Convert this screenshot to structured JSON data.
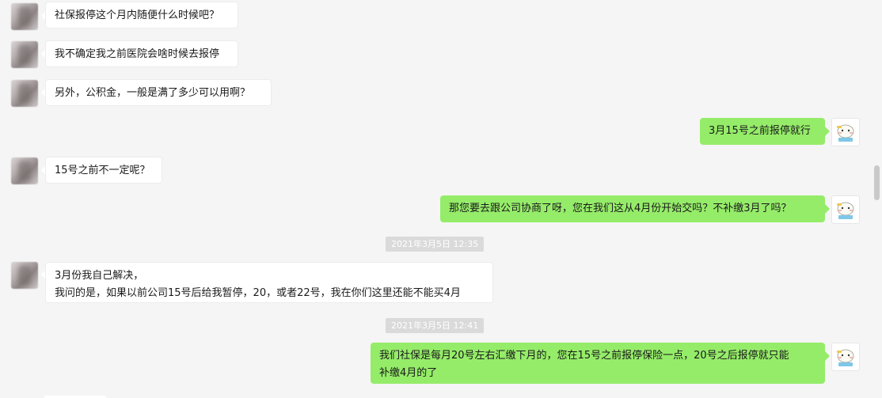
{
  "colors": {
    "background": "#f5f5f5",
    "incoming_bubble": "#ffffff",
    "outgoing_bubble": "#95ec69",
    "timestamp_bg": "#dadada"
  },
  "messages": [
    {
      "side": "in",
      "text": "社保报停这个月内随便什么时候吧？"
    },
    {
      "side": "in",
      "text": "我不确定我之前医院会啥时候去报停"
    },
    {
      "side": "in",
      "text": "另外，公积金，一般是满了多少可以用啊？"
    },
    {
      "side": "out",
      "text": "3月15号之前报停就行"
    },
    {
      "side": "in",
      "text": "15号之前不一定呢？"
    },
    {
      "side": "out",
      "text": "那您要去跟公司协商了呀，您在我们这从4月份开始交吗？不补缴3月了吗？"
    },
    {
      "side": "in",
      "lines": [
        "3月份我自己解决，",
        "我问的是，如果以前公司15号后给我暂停，20，或者22号，我在你们这里还能不能买4月"
      ]
    },
    {
      "side": "out",
      "lines": [
        "我们社保是每月20号左右汇缴下月的，您在15号之前报停保险一点，20号之后报停就只能",
        "补缴4月的了"
      ]
    }
  ],
  "timestamps": [
    "2021年3月5日 12:35",
    "2021年3月5日 12:41"
  ]
}
